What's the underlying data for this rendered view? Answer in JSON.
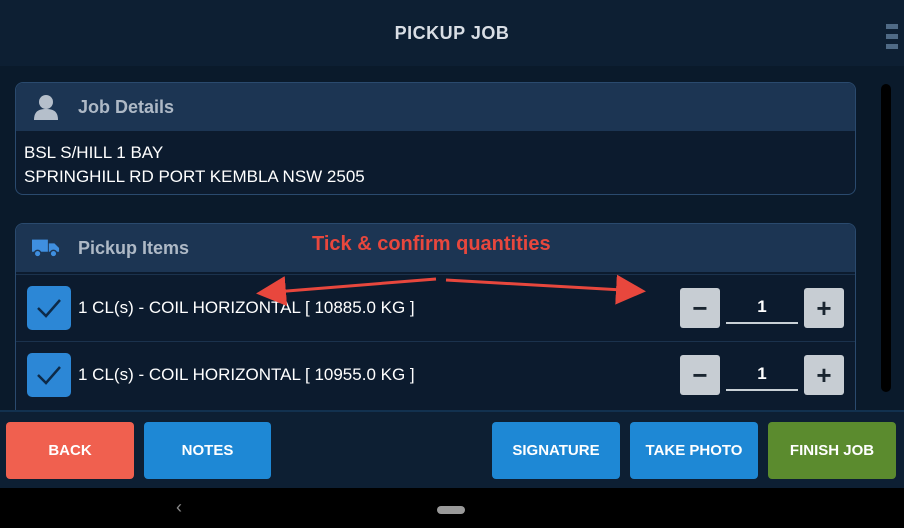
{
  "header": {
    "title": "PICKUP JOB",
    "menu_icon": "grip-icon"
  },
  "job_details": {
    "title": "Job Details",
    "icon": "person-icon",
    "lines": [
      "BSL S/HILL 1 BAY",
      "SPRINGHILL RD PORT KEMBLA NSW 2505"
    ]
  },
  "pickup_items": {
    "title": "Pickup Items",
    "icon": "truck-icon",
    "items": [
      {
        "label": "1 CL(s) - COIL HORIZONTAL [ 10885.0 KG ]",
        "checked": true,
        "quantity": "1"
      },
      {
        "label": "1 CL(s) - COIL HORIZONTAL [ 10955.0 KG ]",
        "checked": true,
        "quantity": "1"
      }
    ],
    "minus_label": "−",
    "plus_label": "+"
  },
  "annotation": {
    "text": "Tick & confirm quantities",
    "color": "#e8473d"
  },
  "toolbar": {
    "back": "BACK",
    "notes": "NOTES",
    "signature": "SIGNATURE",
    "take_photo": "TAKE PHOTO",
    "finish_job": "FINISH JOB"
  },
  "colors": {
    "back": "#f0604f",
    "blue": "#1e88d5",
    "finish": "#5b8b2e",
    "background": "#0a1a2b"
  },
  "navbar": {
    "back_glyph": "‹"
  }
}
